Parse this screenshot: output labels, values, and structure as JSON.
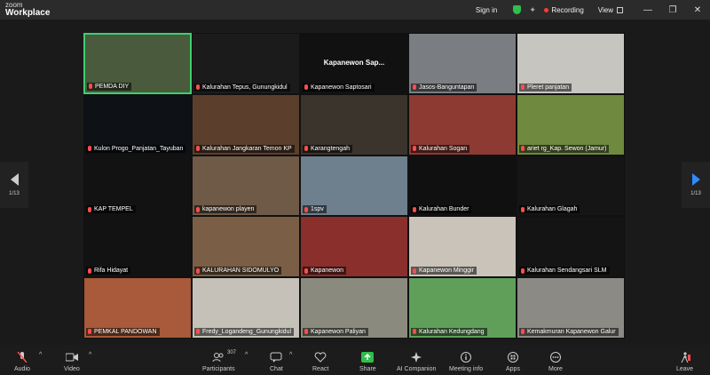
{
  "app": {
    "brand_small": "zoom",
    "brand_large": "Workplace"
  },
  "titlebar": {
    "sign_in": "Sign in",
    "recording": "Recording",
    "view": "View"
  },
  "colors": {
    "active_border": "#3bd16f",
    "recording": "#ff3b30",
    "share": "#2fbf4a",
    "nav_arrow": "#2d8cff"
  },
  "pager": {
    "left": "1/13",
    "right": "1/13"
  },
  "participants": [
    {
      "name": "PEMDA DIY",
      "bg": "#4a5a3c",
      "active": true
    },
    {
      "name": "Kalurahan Tepus, Gunungkidul",
      "bg": "#1b1b1b"
    },
    {
      "name": "Kapanewon Saptosari",
      "bg": "#111",
      "center": "Kapanewon  Sap..."
    },
    {
      "name": "Jasos-Banguntapan",
      "bg": "#7a7d82"
    },
    {
      "name": "Pleret panjatan",
      "bg": "#c7c5c0"
    },
    {
      "name": "Kulon Progo_Panjatan_Tayuban",
      "bg": "#0e1116"
    },
    {
      "name": "Kalurahan Jangkaran Temon KP",
      "bg": "#5b3f2c"
    },
    {
      "name": "Karangtengah",
      "bg": "#3a342c"
    },
    {
      "name": "Kalurahan Sogan",
      "bg": "#8c3a32"
    },
    {
      "name": "ariet rg_Kap. Sewon (Jamur)",
      "bg": "#6f8a3e"
    },
    {
      "name": "KAP TEMPEL",
      "bg": "#121212"
    },
    {
      "name": "kapanewon playen",
      "bg": "#6e5a46"
    },
    {
      "name": "1spv",
      "bg": "#6e7f8e"
    },
    {
      "name": "Kalurahan Bunder",
      "bg": "#101010"
    },
    {
      "name": "Kalurahan Glagah",
      "bg": "#151515"
    },
    {
      "name": "Rifa Hidayat",
      "bg": "#121212"
    },
    {
      "name": "KALURAHAN SIDOMULYO",
      "bg": "#7a5e45"
    },
    {
      "name": "Kapanewon",
      "bg": "#8a2f2c"
    },
    {
      "name": "Kapanewon Minggir",
      "bg": "#c9c3b9"
    },
    {
      "name": "Kalurahan Sendangsari SLM",
      "bg": "#141414"
    },
    {
      "name": "PEMKAL PANDOWAN",
      "bg": "#a85a3a"
    },
    {
      "name": "Fredy_Logandeng_Gunungkidul",
      "bg": "#c5c1b8"
    },
    {
      "name": "Kapanewon Paliyan",
      "bg": "#8a8a7e"
    },
    {
      "name": "Kalurahan Kedungdang",
      "bg": "#5f9f5a"
    },
    {
      "name": "Kemakmuran Kapanewon Galur",
      "bg": "#8c8a84"
    }
  ],
  "toolbar": {
    "audio": "Audio",
    "video": "Video",
    "participants": "Participants",
    "participants_count": "307",
    "chat": "Chat",
    "react": "React",
    "share": "Share",
    "ai": "AI Companion",
    "meeting_info": "Meeting info",
    "apps": "Apps",
    "more": "More",
    "leave": "Leave"
  }
}
